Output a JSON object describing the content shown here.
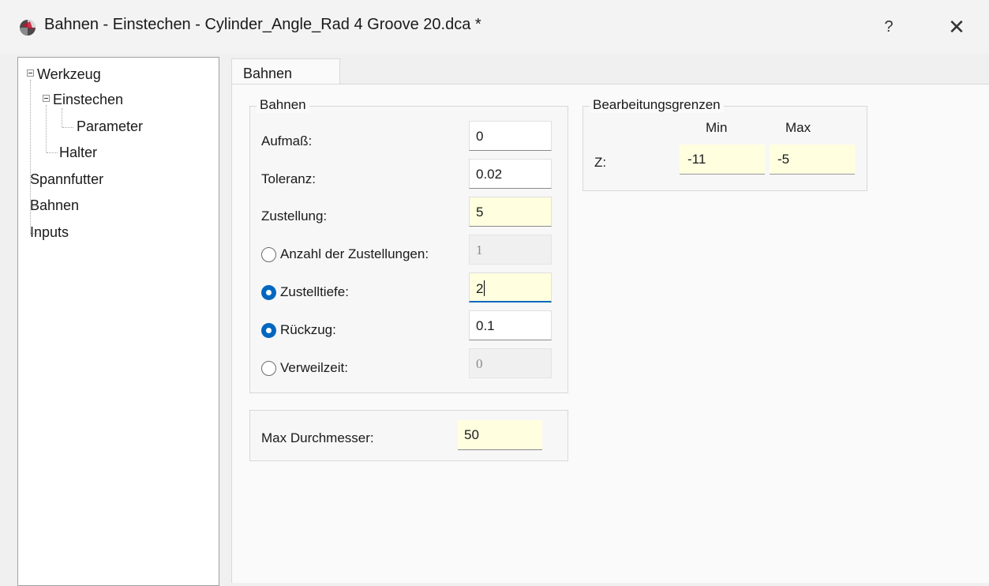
{
  "window": {
    "title": "Bahnen - Einstechen - Cylinder_Angle_Rad 4 Groove 20.dca *",
    "help_label": "?",
    "close_label": "✕",
    "icon": "app-logo-icon"
  },
  "tree": {
    "items": [
      {
        "label": "Werkzeug",
        "expanded": true
      },
      {
        "label": "Einstechen",
        "expanded": true
      },
      {
        "label": "Parameter"
      },
      {
        "label": "Halter"
      },
      {
        "label": "Spannfutter"
      },
      {
        "label": "Bahnen"
      },
      {
        "label": "Inputs"
      }
    ]
  },
  "tab": {
    "label": "Bahnen"
  },
  "bahnen_group": {
    "title": "Bahnen",
    "aufmass": {
      "label": "Aufmaß:",
      "value": "0"
    },
    "toleranz": {
      "label": "Toleranz:",
      "value": "0.02"
    },
    "zustellung": {
      "label": "Zustellung:",
      "value": "5"
    },
    "anzahl": {
      "label": "Anzahl der Zustellungen:",
      "value": "1",
      "selected": false
    },
    "zustelltiefe": {
      "label": "Zustelltiefe:",
      "value": "2",
      "selected": true
    },
    "rueckzug": {
      "label": "Rückzug:",
      "value": "0.1",
      "selected": true
    },
    "verweilzeit": {
      "label": "Verweilzeit:",
      "value": "0",
      "selected": false
    }
  },
  "durchmesser_group": {
    "label": "Max Durchmesser:",
    "value": "50"
  },
  "grenzen_group": {
    "title": "Bearbeitungsgrenzen",
    "min_label": "Min",
    "max_label": "Max",
    "z_label": "Z:",
    "z_min": "-11",
    "z_max": "-5"
  },
  "colors": {
    "accent": "#0067c0",
    "highlight_field": "#ffffe0",
    "background": "#f0f0f0"
  }
}
